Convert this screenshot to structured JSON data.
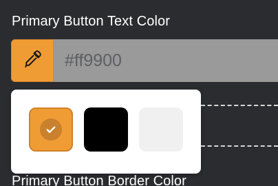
{
  "text_color_field": {
    "label": "Primary Button Text Color",
    "value": "#ff9900",
    "swatch_color": "#f09c34"
  },
  "border_color_field": {
    "label": "Primary Button Border Color"
  },
  "palette": {
    "options": [
      {
        "name": "orange",
        "color": "#f09c34",
        "selected": true
      },
      {
        "name": "black",
        "color": "#000000",
        "selected": false
      },
      {
        "name": "light-gray",
        "color": "#f0f0f0",
        "selected": false
      }
    ]
  },
  "icons": {
    "picker": "eyedropper-icon",
    "selected": "check-icon"
  }
}
